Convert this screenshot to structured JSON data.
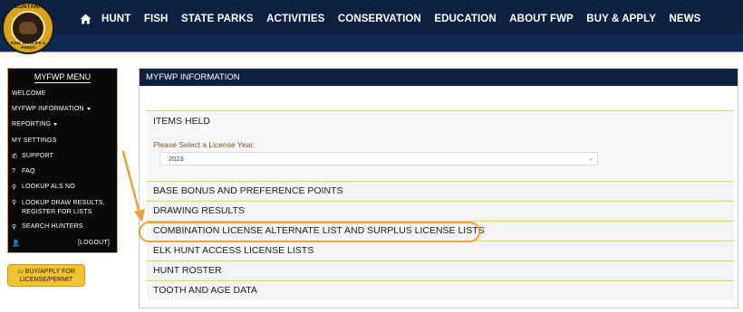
{
  "logo": {
    "top_text": "MONTANA",
    "ring_text": "FISH, WILDLIFE & PARKS"
  },
  "nav": {
    "home_icon": "home-icon",
    "items": [
      "HUNT",
      "FISH",
      "STATE PARKS",
      "ACTIVITIES",
      "CONSERVATION",
      "EDUCATION",
      "ABOUT FWP",
      "BUY & APPLY",
      "NEWS"
    ]
  },
  "sidebar": {
    "title": "MYFWP MENU",
    "items": [
      {
        "label": "WELCOME"
      },
      {
        "label": "MYFWP INFORMATION"
      },
      {
        "label": "REPORTING"
      },
      {
        "label": "MY SETTINGS"
      },
      {
        "label": "SUPPORT",
        "icon": "phone-icon"
      },
      {
        "label": "FAQ",
        "icon": "question-icon"
      },
      {
        "label": "LOOKUP ALS NO",
        "icon": "search-icon"
      },
      {
        "label": "LOOKUP DRAW RESULTS, REGISTER FOR LISTS",
        "icon": "search-icon"
      },
      {
        "label": "SEARCH HUNTERS",
        "icon": "search-icon"
      }
    ],
    "logout": "[LOGOUT]",
    "user_icon": "user-icon"
  },
  "buy_button": {
    "label": "BUY/APPLY FOR LICENSE/PERMIT",
    "icon": "card-icon"
  },
  "panel": {
    "title": "MYFWP INFORMATION",
    "items_held": {
      "title": "ITEMS HELD",
      "select_label": "Please Select a License Year:",
      "select_value": "2023"
    },
    "sections": [
      "BASE BONUS AND PREFERENCE POINTS",
      "DRAWING RESULTS",
      "COMBINATION LICENSE ALTERNATE LIST AND SURPLUS LICENSE LISTS",
      "ELK HUNT ACCESS LICENSE LISTS",
      "HUNT ROSTER",
      "TOOTH AND AGE DATA"
    ]
  },
  "colors": {
    "navy": "#0d2240",
    "gold": "#c9a441",
    "highlight": "#f0a03a"
  }
}
